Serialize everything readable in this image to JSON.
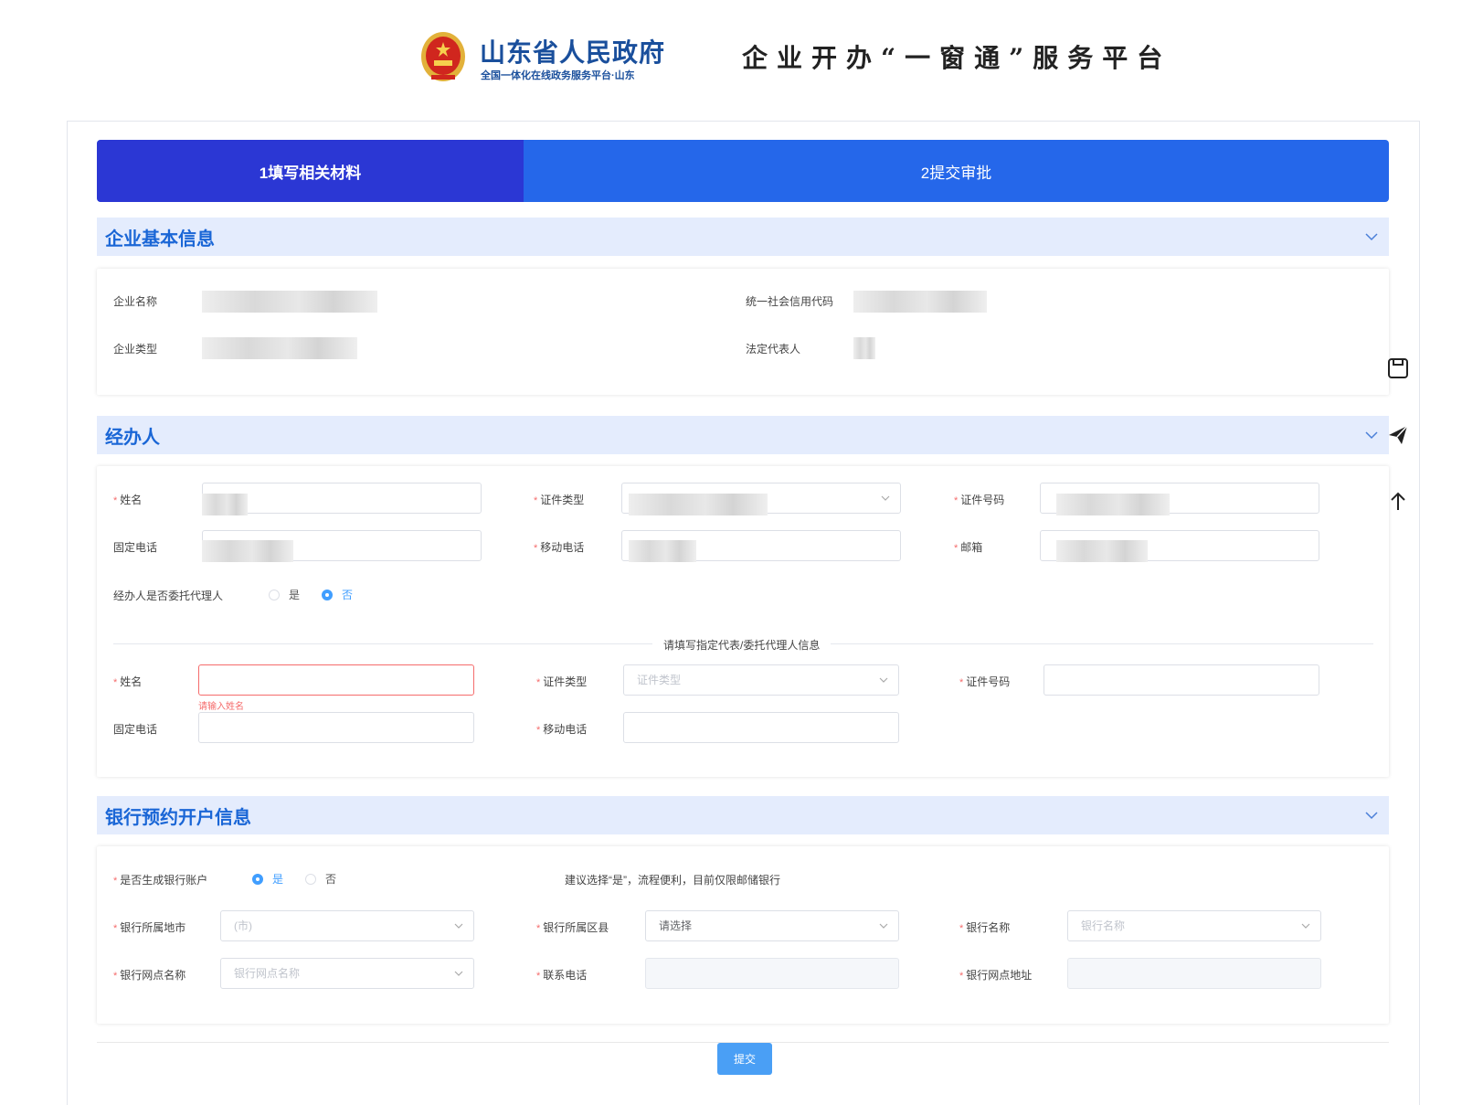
{
  "header": {
    "gov_title": "山东省人民政府",
    "gov_subtitle": "全国一体化在线政务服务平台·山东",
    "platform_title": "企业开办“一窗通”服务平台"
  },
  "steps": [
    {
      "label": "1填写相关材料"
    },
    {
      "label": "2提交审批"
    }
  ],
  "sections": {
    "basic": {
      "title": "企业基本信息",
      "fields": {
        "company_name": "企业名称",
        "credit_code": "统一社会信用代码",
        "company_type": "企业类型",
        "legal_rep": "法定代表人"
      }
    },
    "agent": {
      "title": "经办人",
      "fields": {
        "name": "姓名",
        "id_type": "证件类型",
        "id_no": "证件号码",
        "tel": "固定电话",
        "mobile": "移动电话",
        "email": "邮箱",
        "delegate_q": "经办人是否委托代理人",
        "yes": "是",
        "no": "否"
      },
      "divider": "请填写指定代表/委托代理人信息",
      "proxy": {
        "name": "姓名",
        "name_error": "请输入姓名",
        "id_type": "证件类型",
        "id_type_placeholder": "证件类型",
        "id_no": "证件号码",
        "tel": "固定电话",
        "mobile": "移动电话"
      }
    },
    "bank": {
      "title": "银行预约开户信息",
      "fields": {
        "gen_account_q": "是否生成银行账户",
        "yes": "是",
        "no": "否",
        "hint": "建议选择“是”，流程便利，目前仅限邮储银行",
        "city": "银行所属地市",
        "city_placeholder": "(市)",
        "district": "银行所属区县",
        "district_value": "请选择",
        "bank_name": "银行名称",
        "bank_name_placeholder": "银行名称",
        "branch": "银行网点名称",
        "branch_placeholder": "银行网点名称",
        "phone": "联系电话",
        "address": "银行网点地址"
      }
    }
  },
  "submit_label": "提交",
  "colors": {
    "primary": "#2567ea",
    "active_step": "#2b37d4",
    "section_bg": "#e4ecfd",
    "section_title": "#1a66d6",
    "error": "#f56c6c",
    "radio_on": "#409eff"
  }
}
